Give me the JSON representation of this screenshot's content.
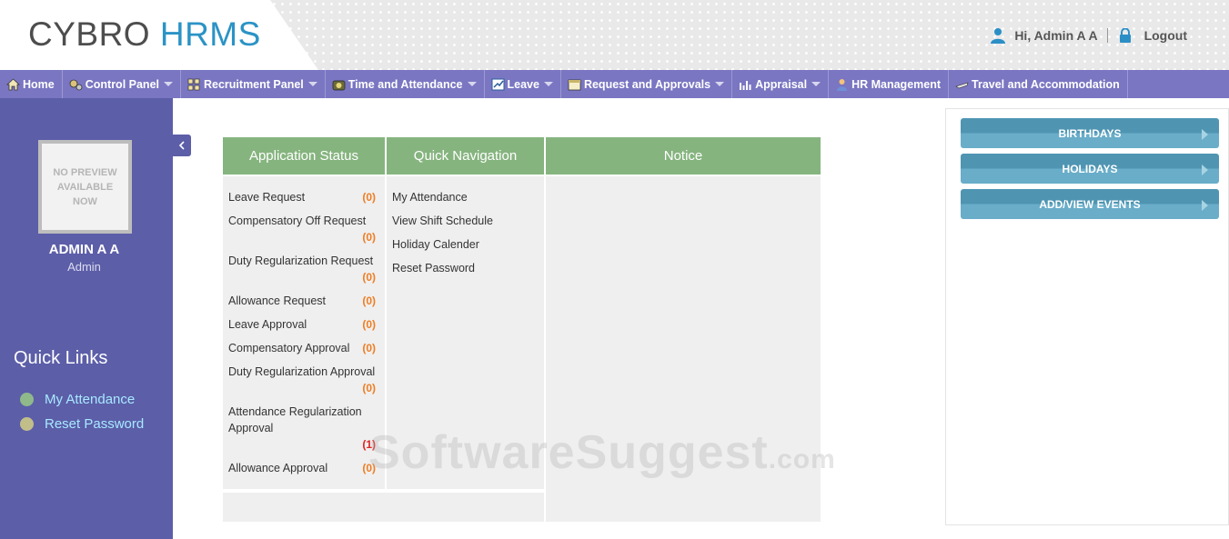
{
  "header": {
    "logo_part1": "CYBRO",
    "logo_part2": "HRMS",
    "greeting": "Hi, Admin A A",
    "logout": "Logout"
  },
  "nav": [
    {
      "label": "Home",
      "icon": "home-icon",
      "dropdown": false
    },
    {
      "label": "Control Panel",
      "icon": "gears-icon",
      "dropdown": true
    },
    {
      "label": "Recruitment Panel",
      "icon": "grid-icon",
      "dropdown": true
    },
    {
      "label": "Time and Attendance",
      "icon": "clock-icon",
      "dropdown": true
    },
    {
      "label": "Leave",
      "icon": "chart-icon",
      "dropdown": true
    },
    {
      "label": "Request and Approvals",
      "icon": "calendar-icon",
      "dropdown": true
    },
    {
      "label": "Appraisal",
      "icon": "bar-chart-icon",
      "dropdown": true
    },
    {
      "label": "HR Management",
      "icon": "person-icon",
      "dropdown": false
    },
    {
      "label": "Travel and Accommodation",
      "icon": "plane-icon",
      "dropdown": false
    }
  ],
  "sidebar": {
    "photo_text": "NO PREVIEW AVAILABLE NOW",
    "user_name": "ADMIN A A",
    "user_role": "Admin",
    "quick_links_title": "Quick Links",
    "quick_links": [
      {
        "label": "My Attendance",
        "dot_color": "#8fb98a"
      },
      {
        "label": "Reset Password",
        "dot_color": "#c2be8a"
      }
    ]
  },
  "panels": {
    "application_status": {
      "title": "Application Status",
      "rows": [
        {
          "label": "Leave Request",
          "count": "(0)"
        },
        {
          "label": "Compensatory Off Request",
          "count": "(0)"
        },
        {
          "label": "Duty Regularization Request",
          "count": "(0)"
        },
        {
          "label": "Allowance Request",
          "count": "(0)"
        },
        {
          "label": "Leave Approval",
          "count": "(0)"
        },
        {
          "label": "Compensatory Approval",
          "count": "(0)"
        },
        {
          "label": "Duty Regularization Approval",
          "count": "(0)"
        },
        {
          "label": "Attendance Regularization Approval",
          "count": "(1)"
        },
        {
          "label": "Allowance Approval",
          "count": "(0)"
        }
      ]
    },
    "quick_navigation": {
      "title": "Quick Navigation",
      "links": [
        "My Attendance",
        "View Shift Schedule",
        "Holiday Calender",
        "Reset Password"
      ]
    },
    "notice": {
      "title": "Notice"
    }
  },
  "right_panel": {
    "buttons": [
      "BIRTHDAYS",
      "HOLIDAYS",
      "ADD/VIEW EVENTS"
    ]
  },
  "watermark": {
    "main": "SoftwareSuggest",
    "suffix": ".com"
  },
  "colors": {
    "nav_bg": "#7a76c2",
    "sidebar_bg": "#5c5ea8",
    "panel_header": "#86b47f",
    "accent_blue": "#2b93c5",
    "count_orange": "#ef7d22",
    "count_red": "#e02222"
  }
}
